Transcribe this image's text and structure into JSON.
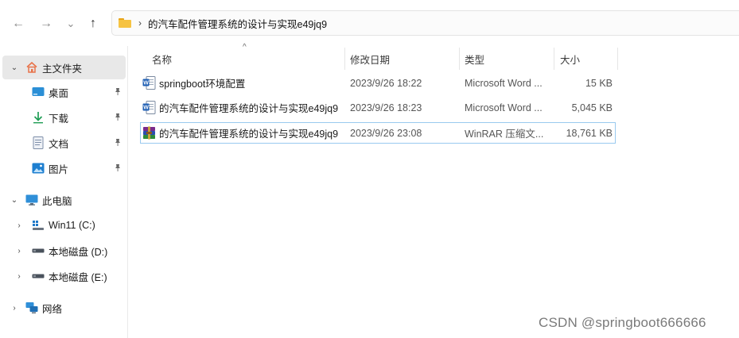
{
  "toolbar": {
    "back_icon": "arrow-left-icon",
    "forward_icon": "arrow-right-icon",
    "recent_icon": "chevron-down-icon",
    "up_icon": "arrow-up-icon",
    "back_glyph": "←",
    "forward_glyph": "→",
    "recent_glyph": "⌄",
    "up_glyph": "↑"
  },
  "address": {
    "separator": "›",
    "path": "的汽车配件管理系统的设计与实现e49jq9"
  },
  "sidebar": {
    "home": {
      "label": "主文件夹",
      "chevron": "⌄"
    },
    "quick": [
      {
        "label": "桌面",
        "pin": "📌"
      },
      {
        "label": "下载",
        "pin": "📌"
      },
      {
        "label": "文档",
        "pin": "📌"
      },
      {
        "label": "图片",
        "pin": "📌"
      }
    ],
    "pc": {
      "label": "此电脑",
      "chevron": "⌄"
    },
    "drives": [
      {
        "label": "Win11 (C:)",
        "chevron": "›"
      },
      {
        "label": "本地磁盘 (D:)",
        "chevron": "›"
      },
      {
        "label": "本地磁盘 (E:)",
        "chevron": "›"
      }
    ],
    "network": {
      "label": "网络",
      "chevron": "›"
    }
  },
  "columns": {
    "name": "名称",
    "modified": "修改日期",
    "type": "类型",
    "size": "大小",
    "sort_glyph": "^"
  },
  "files": [
    {
      "name": "springboot环境配置",
      "modified": "2023/9/26 18:22",
      "type": "Microsoft Word ...",
      "size": "15 KB",
      "icon": "word-doc-icon"
    },
    {
      "name": "的汽车配件管理系统的设计与实现e49jq9",
      "modified": "2023/9/26 18:23",
      "type": "Microsoft Word ...",
      "size": "5,045 KB",
      "icon": "word-doc-icon"
    },
    {
      "name": "的汽车配件管理系统的设计与实现e49jq9",
      "modified": "2023/9/26 23:08",
      "type": "WinRAR 压缩文...",
      "size": "18,761 KB",
      "icon": "winrar-archive-icon"
    }
  ],
  "watermark": "CSDN @springboot666666",
  "colors": {
    "accent": "#0067c0",
    "selection_border": "#99c9ef",
    "sidebar_selected": "#e8e8e8"
  }
}
